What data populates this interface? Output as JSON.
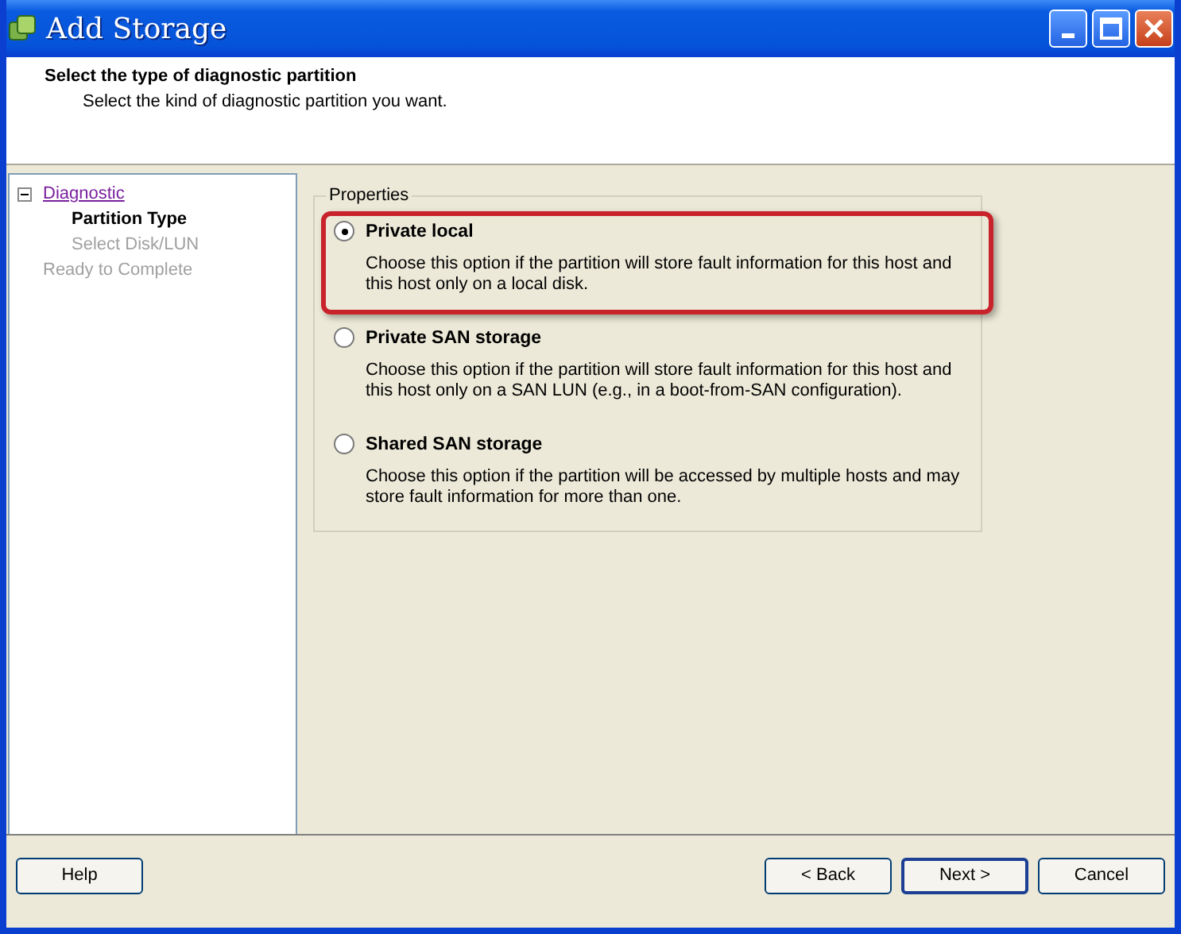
{
  "window": {
    "title": "Add Storage"
  },
  "header": {
    "title": "Select the type of diagnostic partition",
    "subtitle": "Select the kind of diagnostic partition you want."
  },
  "steps": [
    {
      "label": "Diagnostic",
      "kind": "link",
      "expanded": true,
      "selected": false,
      "children": [
        {
          "label": "Partition Type",
          "kind": "current",
          "selected": true
        },
        {
          "label": "Select Disk/LUN",
          "kind": "disabled",
          "selected": false
        }
      ]
    },
    {
      "label": "Ready to Complete",
      "kind": "disabled",
      "selected": false
    }
  ],
  "properties": {
    "legend": "Properties",
    "options": [
      {
        "label": "Private local",
        "description": "Choose this option if the partition will store fault information for this host and this host only on a local disk.",
        "selected": true,
        "highlighted": true
      },
      {
        "label": "Private SAN storage",
        "description": "Choose this option if the partition will store fault information for this host and this host only on a SAN LUN (e.g., in a boot-from-SAN configuration).",
        "selected": false,
        "highlighted": false
      },
      {
        "label": "Shared SAN storage",
        "description": "Choose this option if the partition will be accessed by multiple hosts and may store fault information for more than one.",
        "selected": false,
        "highlighted": false
      }
    ]
  },
  "buttons": [
    {
      "label": "Help",
      "kind": "help"
    },
    {
      "label": "< Back",
      "kind": "nav"
    },
    {
      "label": "Next >",
      "kind": "default"
    },
    {
      "label": "Cancel",
      "kind": "nav"
    }
  ]
}
